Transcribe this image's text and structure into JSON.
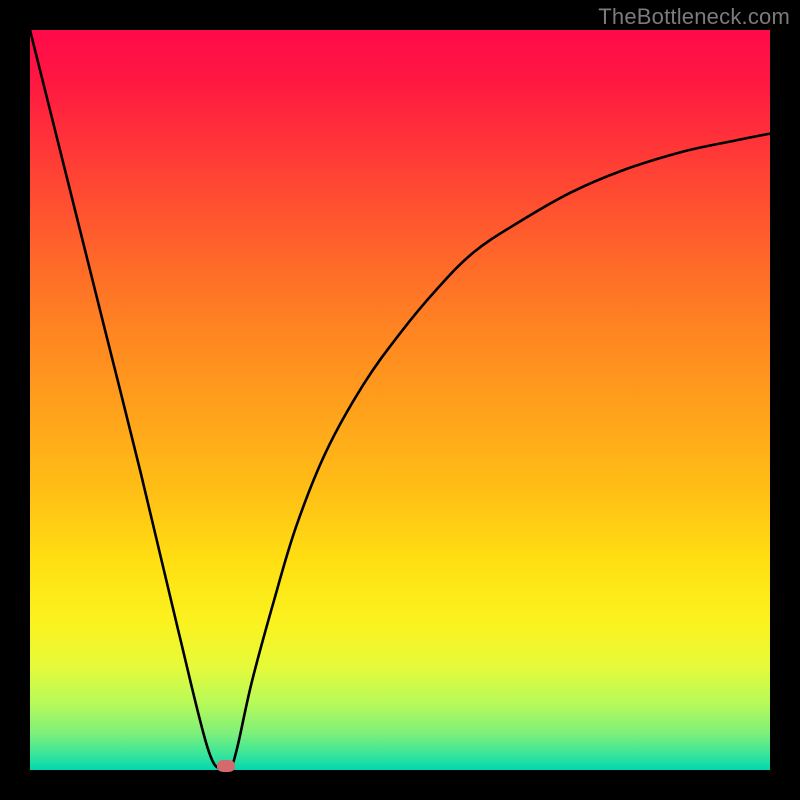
{
  "watermark": "TheBottleneck.com",
  "chart_data": {
    "type": "line",
    "title": "",
    "xlabel": "",
    "ylabel": "",
    "xlim": [
      0,
      100
    ],
    "ylim": [
      0,
      100
    ],
    "grid": false,
    "background_gradient": {
      "direction": "vertical",
      "stops": [
        {
          "pos": 0,
          "color": "#ff0a4a"
        },
        {
          "pos": 17,
          "color": "#ff3a36"
        },
        {
          "pos": 40,
          "color": "#ff8322"
        },
        {
          "pos": 63,
          "color": "#ffc115"
        },
        {
          "pos": 80,
          "color": "#fbf21f"
        },
        {
          "pos": 91,
          "color": "#b7fa59"
        },
        {
          "pos": 100,
          "color": "#00d7b0"
        }
      ]
    },
    "series": [
      {
        "name": "bottleneck-curve",
        "color": "#000000",
        "x": [
          0,
          5,
          10,
          15,
          20,
          24,
          26,
          27,
          28,
          30,
          33,
          36,
          40,
          45,
          50,
          55,
          60,
          66,
          73,
          80,
          88,
          95,
          100
        ],
        "y": [
          100,
          80,
          60,
          40,
          19,
          3,
          0,
          0,
          3,
          12,
          23,
          33,
          43,
          52,
          59,
          65,
          70,
          74,
          78,
          81,
          83.5,
          85,
          86
        ]
      }
    ],
    "marker": {
      "name": "minimum-point",
      "x": 26.5,
      "y": 0.5,
      "color": "#d46a6d"
    }
  }
}
